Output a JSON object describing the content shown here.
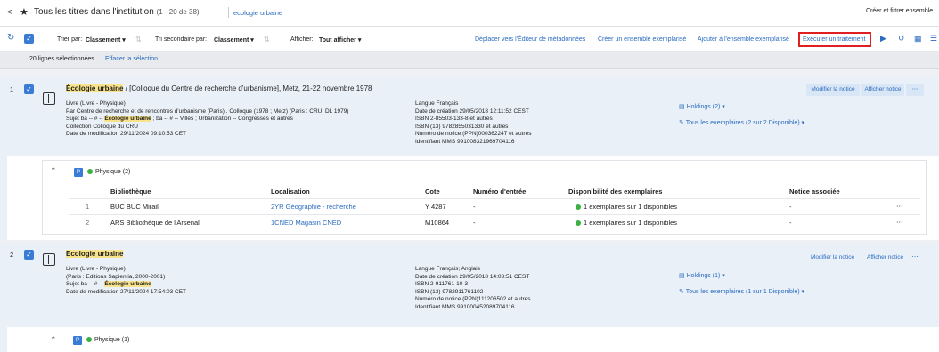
{
  "header": {
    "back_arrow": "<",
    "title": "Tous les titres dans l'institution",
    "count": "(1 - 20 de 38)",
    "search_term": "ecologie urbaine",
    "create_button": "Créer et filtrer ensemble"
  },
  "toolbar": {
    "sort_label": "Trier par:",
    "sort_value": "Classement",
    "secondary_sort_label": "Tri secondaire par:",
    "secondary_sort_value": "Classement",
    "display_label": "Afficher:",
    "display_value": "Tout afficher",
    "actions": [
      "Déplacer vers l'Éditeur de métadonnées",
      "Créer un ensemble exemplarisé",
      "Ajouter à l'ensemble exemplarisé",
      "Exécuter un traitement"
    ]
  },
  "selection": {
    "count_text": "20 lignes sélectionnées",
    "clear_text": "Effacer la sélection"
  },
  "records": [
    {
      "index": "1",
      "title_hl": "Écologie urbaine",
      "title_rest": " / [Colloque du Centre de recherche d'urbanisme], Metz, 21-22 novembre 1978",
      "type": "Livre (Livre - Physique)",
      "line2": "Par Centre de recherche et de rencontres d'urbanisme (Paris) . Colloque (1978 ; Metz) (Paris : CRU, DL 1979)",
      "subject_prefix": "Sujet ba -- # -- ",
      "subject_hl": "Écologie urbaine",
      "subject_rest": " ; ba -- # -- Villes ; Urbanization -- Congresses et autres",
      "collection": "Collection Colloque du CRU",
      "modified": "Date de modification 29/11/2024 09:10:53 CET",
      "mid": [
        "Langue Français",
        "Date de création 29/05/2018 12:11:52 CEST",
        "ISBN 2-85503-133-8 et autres",
        "ISBN (13) 9782855031330 et autres",
        "Numéro de notice (PPN)000362247 et autres",
        "Identifiant MMS 991008321969704116"
      ],
      "holdings": "Holdings (2)",
      "items": "Tous les exemplaires (2 sur 2 Disponible)",
      "btn_edit": "Modifier la notice",
      "btn_view": "Afficher notice"
    },
    {
      "index": "2",
      "title_hl": "Ecologie urbaine",
      "type": "Livre (Livre - Physique)",
      "line2": "(Paris : Editions Sapientia, 2000-2001)",
      "subject_prefix": "Sujet ba -- # -- ",
      "subject_hl": "Écologie urbaine",
      "modified": "Date de modification 27/11/2024 17:54:03 CET",
      "mid": [
        "Langue Français; Anglais",
        "Date de création 29/05/2018 14:03:51 CEST",
        "ISBN 2-911761-10-3",
        "ISBN (13) 9782911761102",
        "Numéro de notice (PPN)111206502 et autres",
        "Identifiant MMS 991000452089704116"
      ],
      "holdings": "Holdings (1)",
      "items": "Tous les exemplaires (1 sur 1 Disponible)",
      "btn_edit": "Modifier la notice",
      "btn_view": "Afficher notice"
    }
  ],
  "physical": {
    "badge": "P",
    "label1": "Physique (2)",
    "label2": "Physique (1)",
    "columns": [
      "Bibliothèque",
      "Localisation",
      "Cote",
      "Numéro d'entrée",
      "Disponibilité des exemplaires",
      "Notice associée"
    ],
    "rows": [
      {
        "n": "1",
        "lib": "BUC BUC Mirail",
        "loc": "2YR Géographie - recherche",
        "cote": "Y 4287",
        "num": "-",
        "dispo": "1 exemplaires sur 1 disponibles",
        "assoc": "-"
      },
      {
        "n": "2",
        "lib": "ARS Bibliothèque de l'Arsenal",
        "loc": "1CNED Magasin CNED",
        "cote": "M10864",
        "num": "-",
        "dispo": "1 exemplaires sur 1 disponibles",
        "assoc": "-"
      }
    ]
  },
  "colors": {
    "accent": "#2a6bbf",
    "highlight": "#f9e38a",
    "available": "#3cb043",
    "redbox": "#e02020"
  }
}
